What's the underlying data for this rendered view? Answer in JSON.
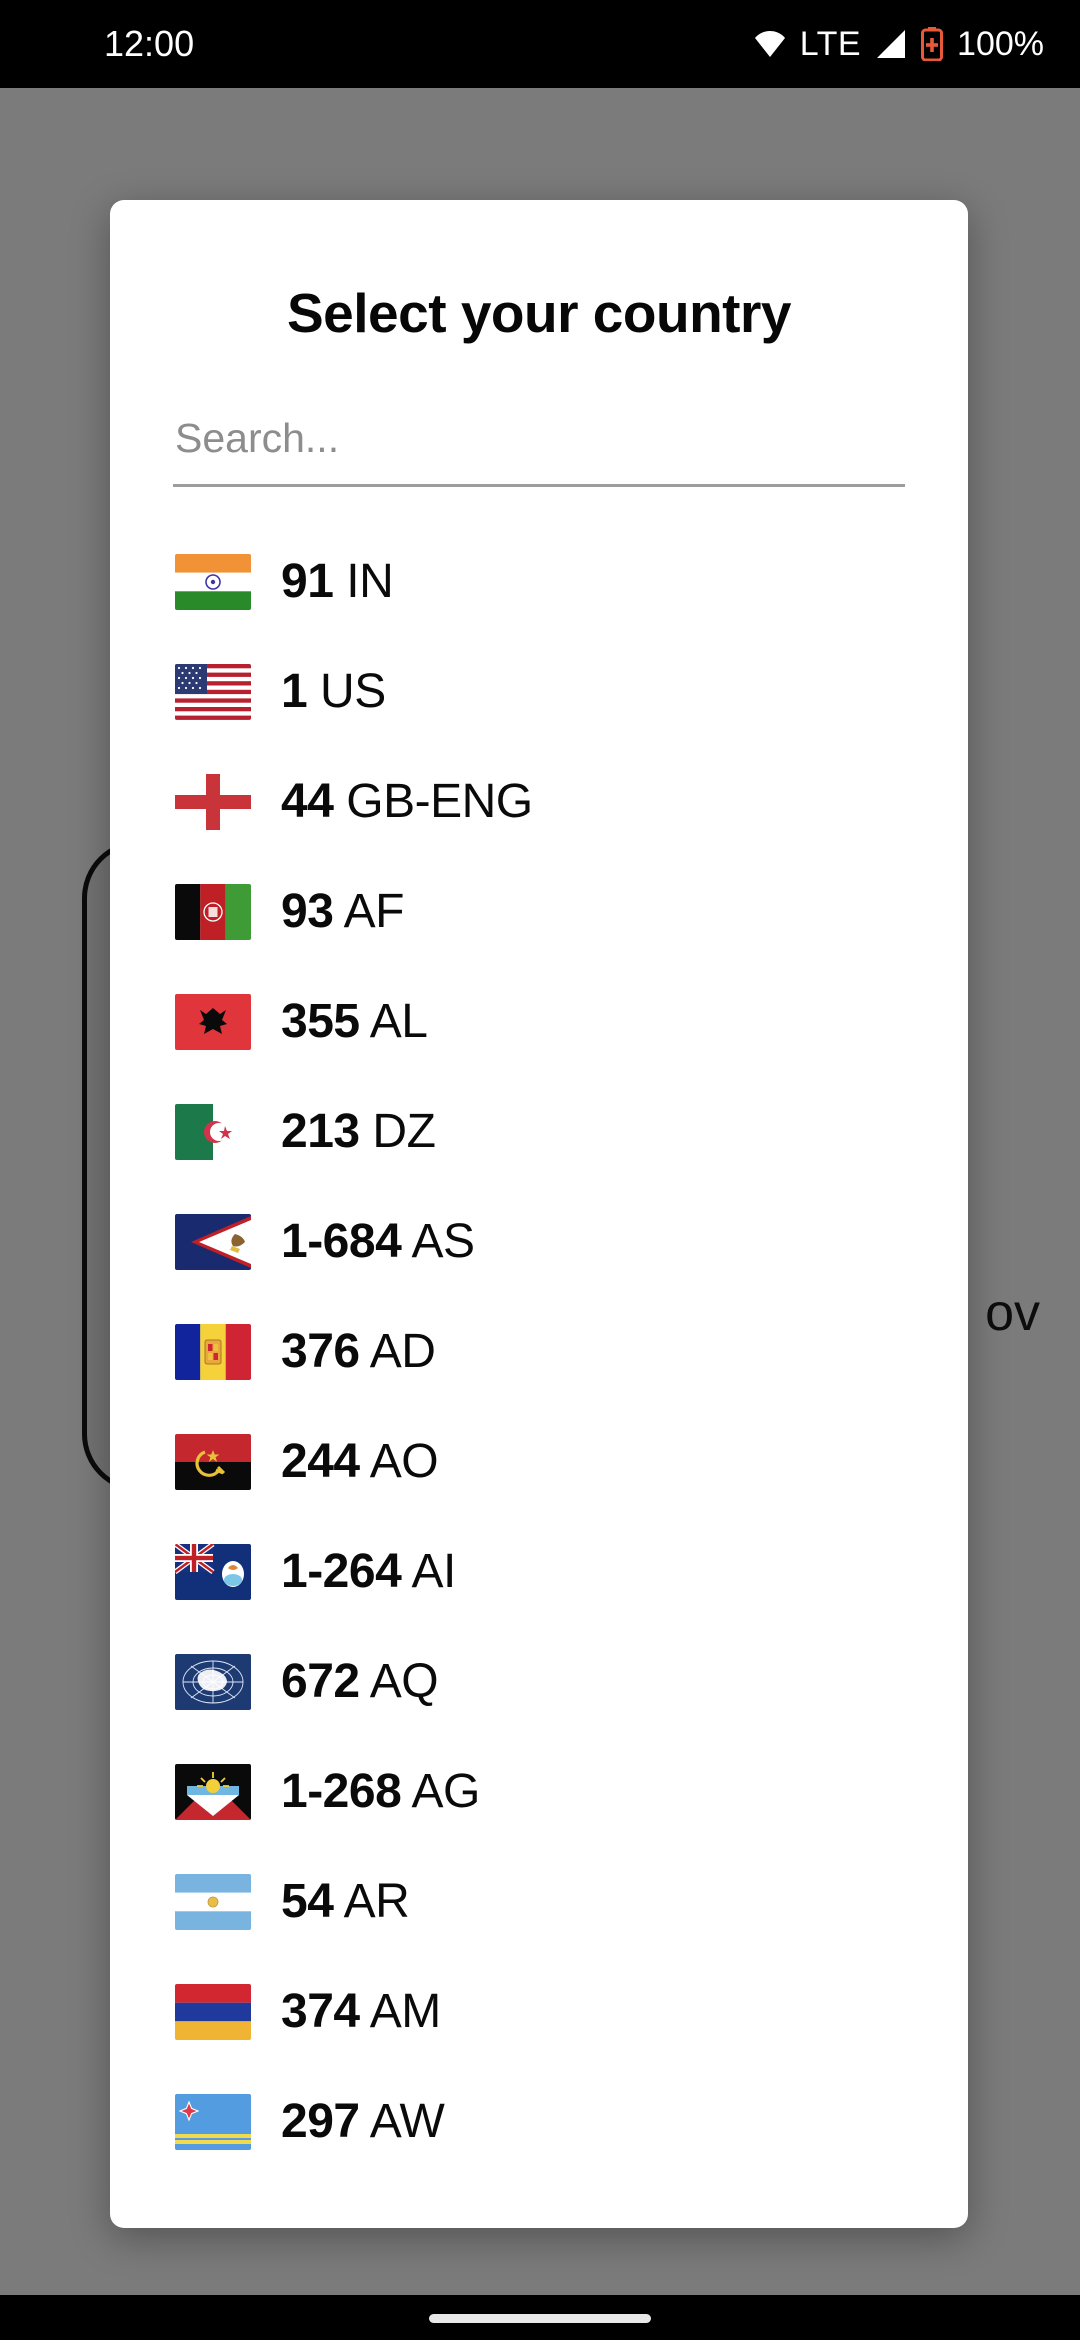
{
  "status_bar": {
    "time": "12:00",
    "network_label": "LTE",
    "battery_percent": "100%",
    "icons": [
      "wifi-icon",
      "signal-icon",
      "battery-icon"
    ],
    "battery_color": "#e8593a",
    "background": "#000000",
    "foreground": "#ffffff"
  },
  "background_app": {
    "visible_text_fragment": "ov",
    "scrim_color": "#7b7b7b",
    "card_border_color": "#0b0b0b"
  },
  "dialog": {
    "title": "Select your country",
    "background": "#ffffff",
    "search": {
      "placeholder": "Search...",
      "value": "",
      "underline_color": "#9d9d9d",
      "placeholder_color": "#8d8d8d"
    },
    "countries": [
      {
        "dial_code": "91",
        "iso": "IN",
        "flag": "flag-india"
      },
      {
        "dial_code": "1",
        "iso": "US",
        "flag": "flag-united-states"
      },
      {
        "dial_code": "44",
        "iso": "GB-ENG",
        "flag": "flag-england"
      },
      {
        "dial_code": "93",
        "iso": "AF",
        "flag": "flag-afghanistan"
      },
      {
        "dial_code": "355",
        "iso": "AL",
        "flag": "flag-albania"
      },
      {
        "dial_code": "213",
        "iso": "DZ",
        "flag": "flag-algeria"
      },
      {
        "dial_code": "1-684",
        "iso": "AS",
        "flag": "flag-american-samoa"
      },
      {
        "dial_code": "376",
        "iso": "AD",
        "flag": "flag-andorra"
      },
      {
        "dial_code": "244",
        "iso": "AO",
        "flag": "flag-angola"
      },
      {
        "dial_code": "1-264",
        "iso": "AI",
        "flag": "flag-anguilla"
      },
      {
        "dial_code": "672",
        "iso": "AQ",
        "flag": "flag-antarctica"
      },
      {
        "dial_code": "1-268",
        "iso": "AG",
        "flag": "flag-antigua-and-barbuda"
      },
      {
        "dial_code": "54",
        "iso": "AR",
        "flag": "flag-argentina"
      },
      {
        "dial_code": "374",
        "iso": "AM",
        "flag": "flag-armenia"
      },
      {
        "dial_code": "297",
        "iso": "AW",
        "flag": "flag-aruba"
      }
    ]
  },
  "nav_bar": {
    "home_indicator": "home-indicator",
    "background": "#000000"
  }
}
